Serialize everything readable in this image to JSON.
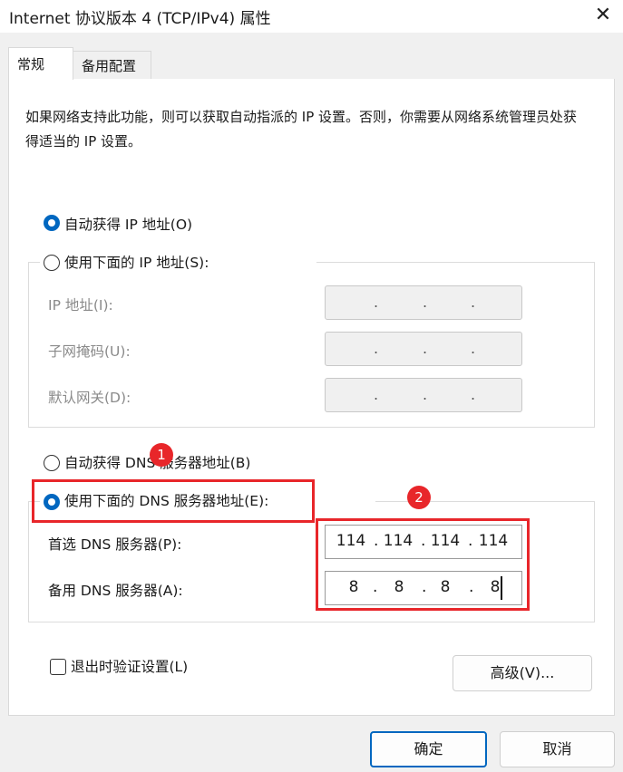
{
  "window": {
    "title": "Internet 协议版本 4 (TCP/IPv4) 属性",
    "close_glyph": "✕"
  },
  "tabs": [
    {
      "label": "常规"
    },
    {
      "label": "备用配置"
    }
  ],
  "description": "如果网络支持此功能，则可以获取自动指派的 IP 设置。否则，你需要从网络系统管理员处获得适当的 IP 设置。",
  "ip_section": {
    "auto_label": "自动获得 IP 地址(O)",
    "manual_label": "使用下面的 IP 地址(S):",
    "auto_selected": true,
    "fields": [
      {
        "label": "IP 地址(I):"
      },
      {
        "label": "子网掩码(U):"
      },
      {
        "label": "默认网关(D):"
      }
    ],
    "dot": "."
  },
  "dns_section": {
    "auto_label": "自动获得 DNS 服务器地址(B)",
    "manual_label": "使用下面的 DNS 服务器地址(E):",
    "manual_selected": true,
    "preferred_label": "首选 DNS 服务器(P):",
    "preferred_octets": [
      "114",
      "114",
      "114",
      "114"
    ],
    "alternate_label": "备用 DNS 服务器(A):",
    "alternate_octets": [
      "8",
      "8",
      "8",
      "8"
    ],
    "dot": "."
  },
  "annotations": {
    "badge1": "1",
    "badge2": "2",
    "highlight_color": "#e8262a"
  },
  "validate_on_exit": {
    "label": "退出时验证设置(L)",
    "checked": false
  },
  "buttons": {
    "advanced": "高级(V)...",
    "ok": "确定",
    "cancel": "取消"
  },
  "colors": {
    "accent": "#0067c0"
  }
}
